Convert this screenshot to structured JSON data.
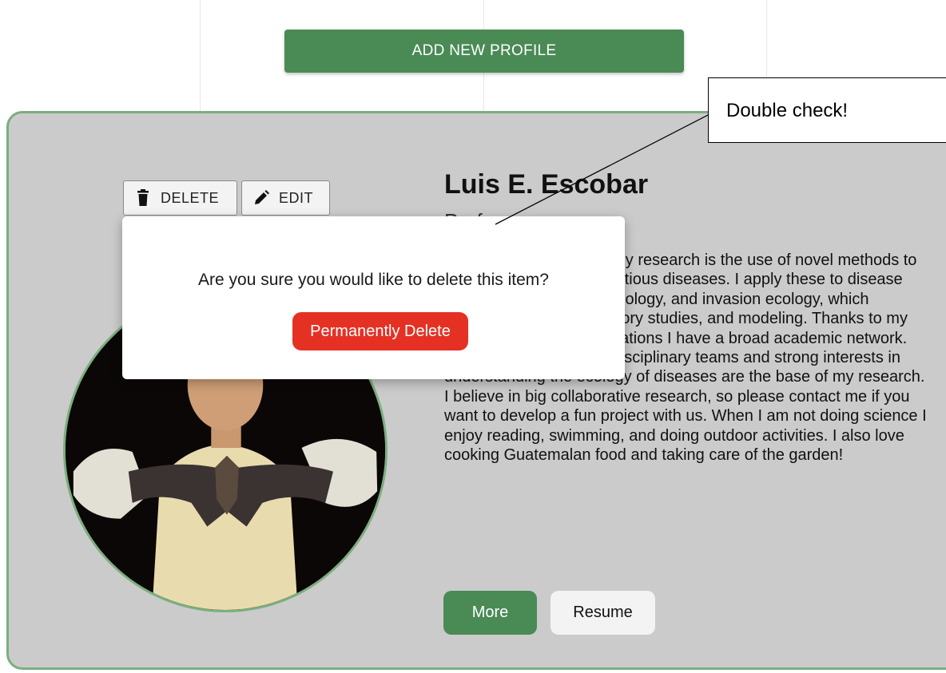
{
  "header": {
    "add_profile_label": "ADD NEW PROFILE"
  },
  "profile": {
    "name": "Luis E. Escobar",
    "title_partial": "Prof",
    "bio": "A central component of my research is the use of novel methods to study the ecology of infectious diseases. I apply these to disease biogeography, disease ecology, and invasion ecology, which includes field and laboratory studies, and modeling. Thanks to my past and current collaborations I have a broad academic network. Working as part of multidisciplinary teams and strong interests in understanding the ecology of diseases are the base of my research. I believe in big collaborative research, so please contact me if you want to develop a fun project with us. When I am not doing science I enjoy reading, swimming, and doing outdoor activities. I also love cooking Guatemalan food and taking care of the garden!",
    "delete_label": "DELETE",
    "edit_label": "EDIT",
    "more_label": "More",
    "resume_label": "Resume"
  },
  "dialog": {
    "message": "Are you sure you would like to delete this item?",
    "confirm_label": "Permanently Delete"
  },
  "annotation": {
    "text": "Double check!"
  },
  "colors": {
    "accent_green": "#4a8a55",
    "card_border_green": "#7cae7e",
    "card_background": "#cbcbcb",
    "danger_red": "#e53124"
  },
  "icons": {
    "delete": "trash-icon",
    "edit": "pencil-icon"
  }
}
